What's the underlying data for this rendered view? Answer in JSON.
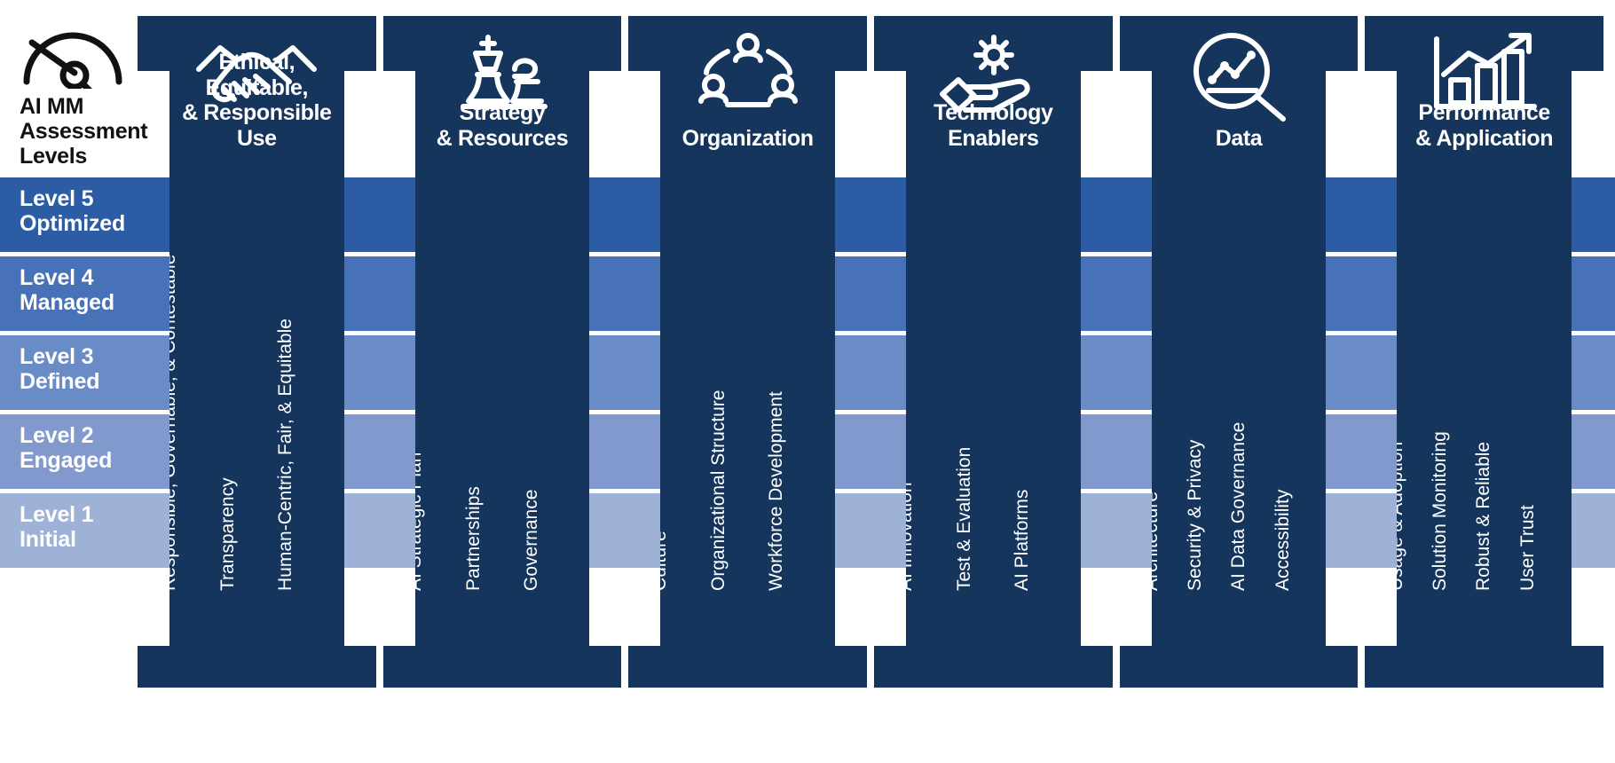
{
  "legend": {
    "icon": "gauge-meter-icon",
    "title": "AI MM\nAssessment\nLevels",
    "title_lines": [
      "AI MM",
      "Assessment",
      "Levels"
    ],
    "levels": [
      {
        "num": "Level 5",
        "name": "Optimized",
        "color": "#2c5ca4"
      },
      {
        "num": "Level 4",
        "name": "Managed",
        "color": "#4772b8"
      },
      {
        "num": "Level 3",
        "name": "Defined",
        "color": "#6a8cc6"
      },
      {
        "num": "Level 2",
        "name": "Engaged",
        "color": "#8199cd"
      },
      {
        "num": "Level 1",
        "name": "Initial",
        "color": "#9eb2d8"
      }
    ]
  },
  "colors": {
    "pillar_navy": "#15355c",
    "background": "#ffffff",
    "text_light": "#ffffff",
    "text_dark": "#111111"
  },
  "pillars": [
    {
      "title_lines": [
        "Ethical, Equitable,",
        "& Responsible Use"
      ],
      "icon": "handshake-icon",
      "subitems": [
        "Responsible, Governable, & Contestable",
        "Transparency",
        "Human-Centric, Fair, & Equitable"
      ]
    },
    {
      "title_lines": [
        "Strategy",
        "& Resources"
      ],
      "icon": "chess-king-icon",
      "subitems": [
        "AI Strategic Plan",
        "Partnerships",
        "Governance"
      ]
    },
    {
      "title_lines": [
        "Organization"
      ],
      "icon": "people-network-icon",
      "subitems": [
        "Culture",
        "Organizational Structure",
        "Workforce Development"
      ]
    },
    {
      "title_lines": [
        "Technology",
        "Enablers"
      ],
      "icon": "hand-gear-icon",
      "subitems": [
        "AI Innovation",
        "Test & Evaluation",
        "AI Platforms"
      ]
    },
    {
      "title_lines": [
        "Data"
      ],
      "icon": "magnifier-chart-icon",
      "subitems": [
        "Architecture",
        "Security & Privacy",
        "AI Data Governance",
        "Accessibility"
      ]
    },
    {
      "title_lines": [
        "Performance",
        "& Application"
      ],
      "icon": "bar-chart-arrow-icon",
      "subitems": [
        "Usage & Adoption",
        "Solution Monitoring",
        "Robust & Reliable",
        "User Trust"
      ]
    }
  ]
}
